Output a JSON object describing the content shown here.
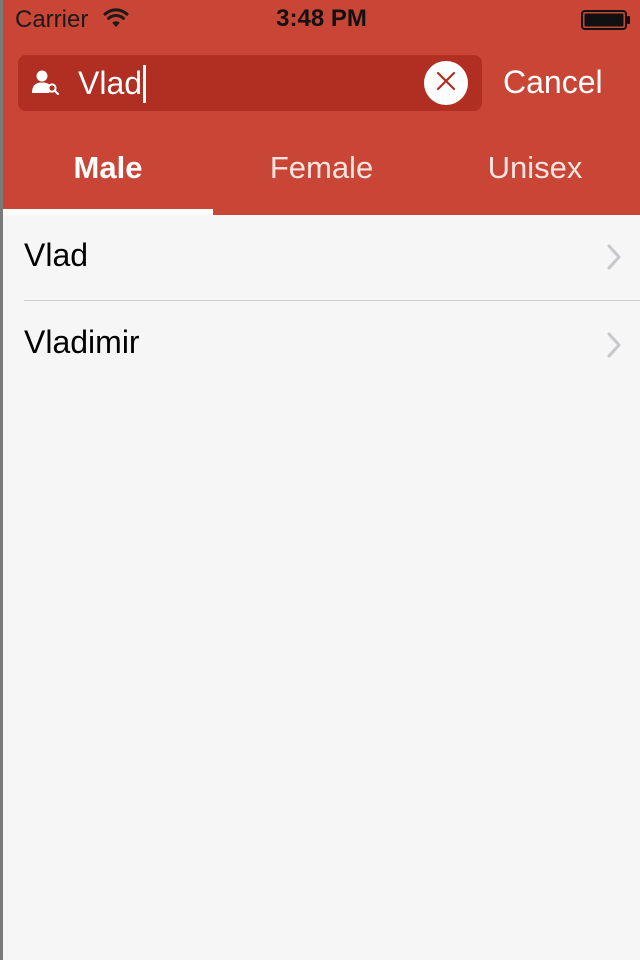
{
  "status_bar": {
    "carrier": "Carrier",
    "time": "3:48 PM",
    "icons": [
      "wifi-icon",
      "battery-icon"
    ]
  },
  "search": {
    "value": "Vlad",
    "icon": "person-search-icon",
    "clear_icon": "clear-icon",
    "cancel_label": "Cancel"
  },
  "tabs": [
    {
      "label": "Male",
      "active": true
    },
    {
      "label": "Female",
      "active": false
    },
    {
      "label": "Unisex",
      "active": false
    }
  ],
  "results": [
    {
      "name": "Vlad"
    },
    {
      "name": "Vladimir"
    }
  ],
  "colors": {
    "header": "#c94535",
    "search_field": "#b02e22",
    "background": "#f6f6f6",
    "chevron": "#c7c7cc"
  }
}
